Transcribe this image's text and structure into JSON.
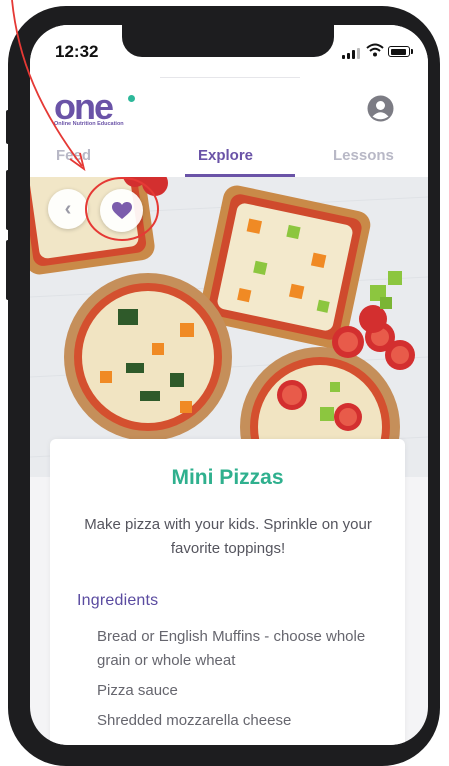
{
  "status_bar": {
    "time": "12:32"
  },
  "app": {
    "logo_text": "one",
    "logo_subtitle": "Online Nutrition Education",
    "profile_icon": "user-circle-icon",
    "accent_color": "#6a53a7",
    "title_color": "#2fb08e"
  },
  "tabs": [
    {
      "label": "Feed",
      "active": false
    },
    {
      "label": "Explore",
      "active": true
    },
    {
      "label": "Lessons",
      "active": false
    }
  ],
  "hero": {
    "back_icon": "chevron-left-icon",
    "favorite_icon": "heart-icon"
  },
  "recipe": {
    "title": "Mini Pizzas",
    "description": "Make pizza with your kids. Sprinkle on your favorite toppings!",
    "ingredients_heading": "Ingredients",
    "ingredients": [
      "Bread or English Muffins - choose whole grain or whole wheat",
      "Pizza sauce",
      "Shredded mozzarella cheese"
    ]
  }
}
